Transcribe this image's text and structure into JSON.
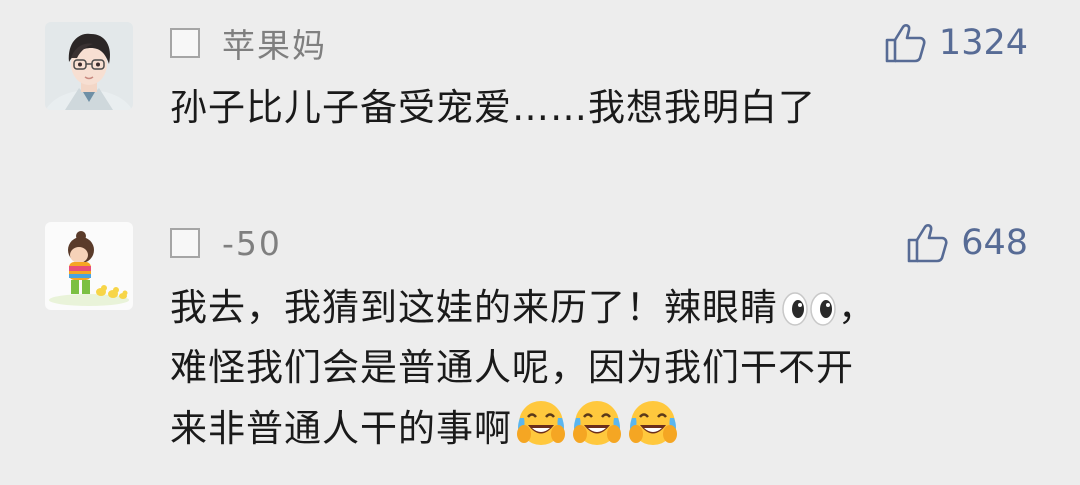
{
  "comments": [
    {
      "nickname": "苹果妈",
      "likes": "1324",
      "avatar_icon": "young-man-with-glasses-avatar",
      "text_lines": [
        "孙子比儿子备受宠爱……我想我明白了"
      ]
    },
    {
      "nickname": "-50",
      "likes": "648",
      "avatar_icon": "child-with-ducklings-avatar",
      "text_lines": [
        "我去，我猜到这娃的来历了！辣眼睛",
        "，",
        "难怪我们会是普通人呢，因为我们干不开",
        "来非普通人干的事啊"
      ],
      "emojis": [
        "eyes-emoji",
        "crying-laughing-emoji",
        "crying-laughing-emoji",
        "crying-laughing-emoji"
      ]
    }
  ],
  "colors": {
    "background": "#ededed",
    "nickname": "#7f7f7f",
    "like_accent": "#576b95",
    "text": "#1a1a1a"
  }
}
